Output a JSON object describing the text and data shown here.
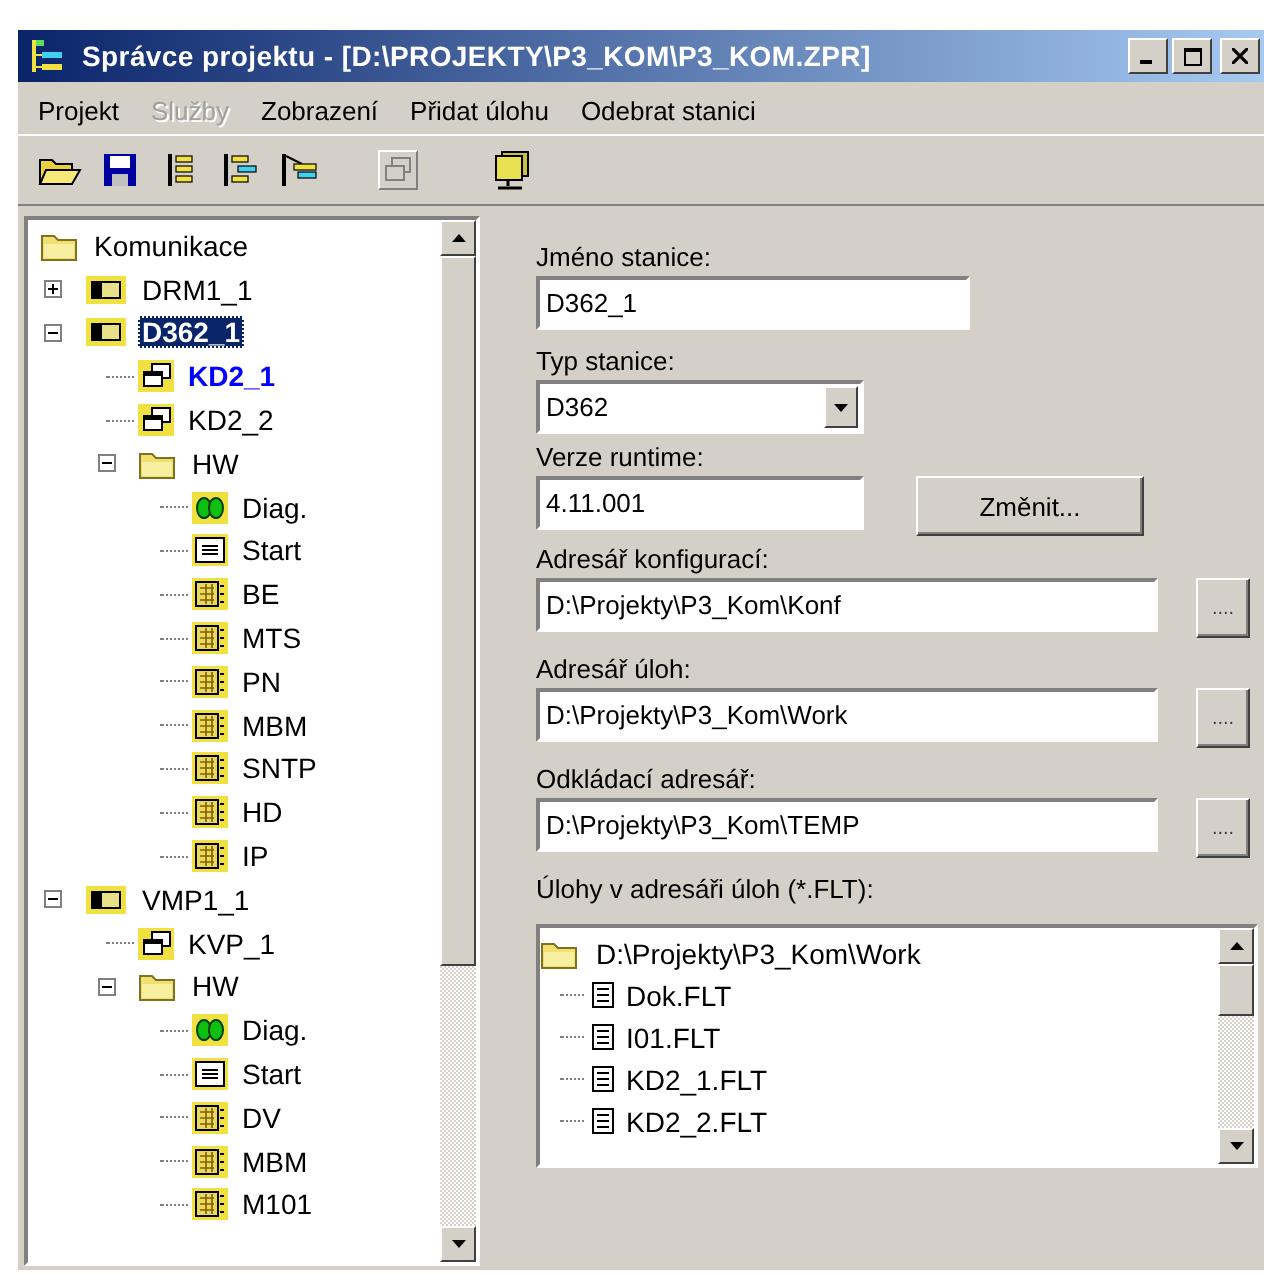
{
  "window": {
    "title": "Správce projektu - [D:\\PROJEKTY\\P3_KOM\\P3_KOM.ZPR]"
  },
  "menu": [
    {
      "label": "Projekt",
      "disabled": false
    },
    {
      "label": "Služby",
      "disabled": true
    },
    {
      "label": "Zobrazení",
      "disabled": false
    },
    {
      "label": "Přidat úlohu",
      "disabled": false
    },
    {
      "label": "Odebrat stanici",
      "disabled": false
    }
  ],
  "toolbar": [
    {
      "kind": "open",
      "disabled": false
    },
    {
      "kind": "save",
      "disabled": false
    },
    {
      "kind": "tree",
      "disabled": false
    },
    {
      "kind": "tree-indent",
      "disabled": false
    },
    {
      "kind": "tree-flag",
      "disabled": false
    },
    {
      "kind": "windows",
      "disabled": true
    },
    {
      "kind": "station",
      "disabled": false
    }
  ],
  "tree": {
    "items": [
      {
        "label": "Komunikace",
        "kind": "folder",
        "selected": false,
        "active": false,
        "children": [
          {
            "label": "DRM1_1",
            "kind": "station",
            "selected": false,
            "active": false,
            "expanded": false
          },
          {
            "label": "D362_1",
            "kind": "station",
            "selected": true,
            "active": false,
            "expanded": true,
            "children": [
              {
                "label": "KD2_1",
                "kind": "task",
                "selected": false,
                "active": true
              },
              {
                "label": "KD2_2",
                "kind": "task",
                "selected": false,
                "active": false
              },
              {
                "label": "HW",
                "kind": "folder",
                "selected": false,
                "active": false,
                "expanded": true,
                "children": [
                  {
                    "label": "Diag.",
                    "kind": "diag",
                    "selected": false,
                    "active": false
                  },
                  {
                    "label": "Start",
                    "kind": "start",
                    "selected": false,
                    "active": false
                  },
                  {
                    "label": "BE",
                    "kind": "module",
                    "selected": false,
                    "active": false
                  },
                  {
                    "label": "MTS",
                    "kind": "module",
                    "selected": false,
                    "active": false
                  },
                  {
                    "label": "PN",
                    "kind": "module",
                    "selected": false,
                    "active": false
                  },
                  {
                    "label": "MBM",
                    "kind": "module",
                    "selected": false,
                    "active": false
                  },
                  {
                    "label": "SNTP",
                    "kind": "module",
                    "selected": false,
                    "active": false
                  },
                  {
                    "label": "HD",
                    "kind": "module",
                    "selected": false,
                    "active": false
                  },
                  {
                    "label": "IP",
                    "kind": "module",
                    "selected": false,
                    "active": false
                  }
                ]
              }
            ]
          },
          {
            "label": "VMP1_1",
            "kind": "station",
            "selected": false,
            "active": false,
            "expanded": true,
            "children": [
              {
                "label": "KVP_1",
                "kind": "task",
                "selected": false,
                "active": false
              },
              {
                "label": "HW",
                "kind": "folder",
                "selected": false,
                "active": false,
                "expanded": true,
                "children": [
                  {
                    "label": "Diag.",
                    "kind": "diag",
                    "selected": false,
                    "active": false
                  },
                  {
                    "label": "Start",
                    "kind": "start",
                    "selected": false,
                    "active": false
                  },
                  {
                    "label": "DV",
                    "kind": "module",
                    "selected": false,
                    "active": false
                  },
                  {
                    "label": "MBM",
                    "kind": "module",
                    "selected": false,
                    "active": false
                  },
                  {
                    "label": "M101",
                    "kind": "module",
                    "selected": false,
                    "active": false
                  }
                ]
              }
            ]
          }
        ]
      }
    ]
  },
  "form": {
    "station_name": {
      "label": "Jméno stanice:",
      "value": "D362_1"
    },
    "station_type": {
      "label": "Typ stanice:",
      "value": "D362"
    },
    "runtime": {
      "label": "Verze runtime:",
      "value": "4.11.001",
      "button": "Změnit..."
    },
    "dirs": [
      {
        "label": "Adresář konfigurací:",
        "value": "D:\\Projekty\\P3_Kom\\Konf",
        "button": "...."
      },
      {
        "label": "Adresář úloh:",
        "value": "D:\\Projekty\\P3_Kom\\Work",
        "button": "...."
      },
      {
        "label": "Odkládací adresář:",
        "value": "D:\\Projekty\\P3_Kom\\TEMP",
        "button": "...."
      }
    ],
    "tasks": {
      "label": "Úlohy v adresáři úloh (*.FLT):",
      "root": "D:\\Projekty\\P3_Kom\\Work",
      "files": [
        "Dok.FLT",
        "I01.FLT",
        "KD2_1.FLT",
        "KD2_2.FLT"
      ]
    }
  }
}
